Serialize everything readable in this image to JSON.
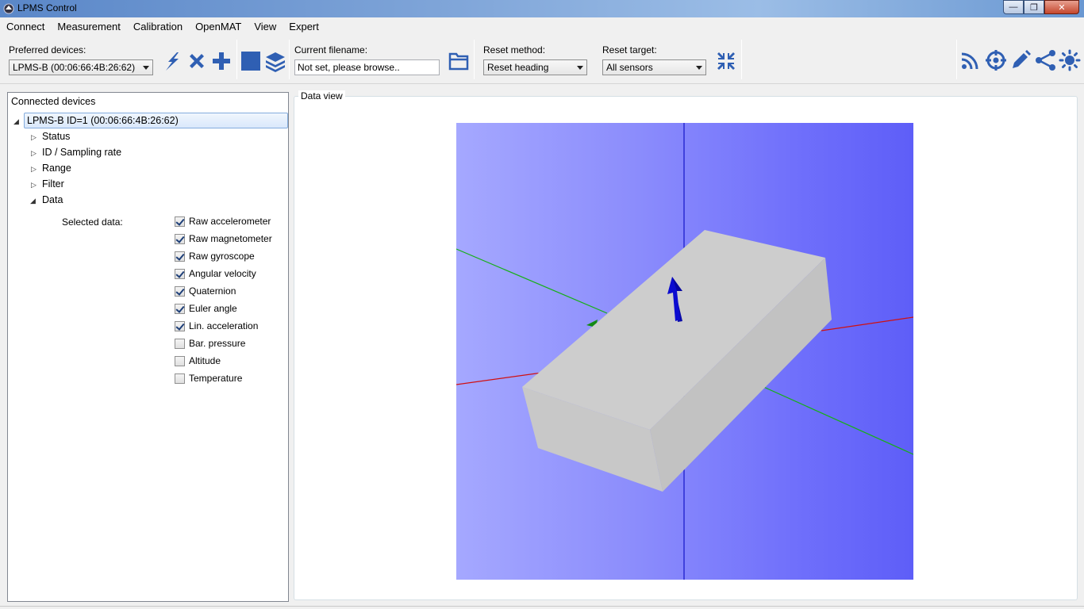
{
  "window": {
    "title": "LPMS Control",
    "minimize": "—",
    "maximize": "❐",
    "close": "✕"
  },
  "menu": [
    "Connect",
    "Measurement",
    "Calibration",
    "OpenMAT",
    "View",
    "Expert"
  ],
  "toolbar": {
    "preferred_devices_label": "Preferred devices:",
    "preferred_device_value": "LPMS-B (00:06:66:4B:26:62)",
    "current_filename_label": "Current filename:",
    "current_filename_value": "Not set, please browse..",
    "reset_method_label": "Reset method:",
    "reset_method_value": "Reset heading",
    "reset_target_label": "Reset target:",
    "reset_target_value": "All sensors",
    "icons": [
      "connect-icon",
      "disconnect-icon",
      "add-sensor-icon",
      "stop-icon",
      "layers-icon",
      "browse-folder-icon",
      "reset-icon",
      "wireless-icon",
      "target-icon",
      "pen-icon",
      "share-icon",
      "brightness-icon"
    ],
    "accent_color": "#2f5fb3"
  },
  "left_panel": {
    "header": "Connected devices",
    "root_node": "LPMS-B ID=1 (00:06:66:4B:26:62)",
    "children": [
      "Status",
      "ID / Sampling rate",
      "Range",
      "Filter",
      "Data"
    ],
    "selected_data_label": "Selected data:",
    "data_options": [
      {
        "label": "Raw accelerometer",
        "checked": true
      },
      {
        "label": "Raw magnetometer",
        "checked": true
      },
      {
        "label": "Raw gyroscope",
        "checked": true
      },
      {
        "label": "Angular velocity",
        "checked": true
      },
      {
        "label": "Quaternion",
        "checked": true
      },
      {
        "label": "Euler angle",
        "checked": true
      },
      {
        "label": "Lin. acceleration",
        "checked": true
      },
      {
        "label": "Bar. pressure",
        "checked": false
      },
      {
        "label": "Altitude",
        "checked": false
      },
      {
        "label": "Temperature",
        "checked": false
      }
    ]
  },
  "data_view": {
    "title": "Data view",
    "background_color": "#7a7bfc",
    "box_color": "#cbcbcb"
  }
}
